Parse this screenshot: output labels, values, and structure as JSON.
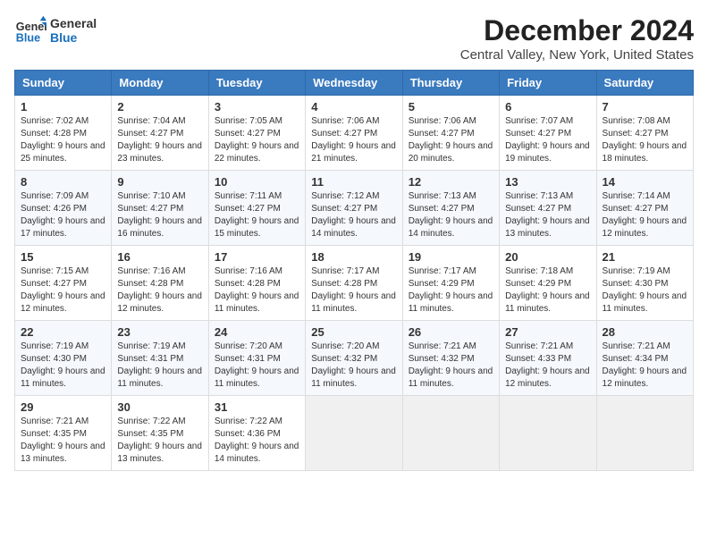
{
  "logo": {
    "line1": "General",
    "line2": "Blue"
  },
  "title": "December 2024",
  "location": "Central Valley, New York, United States",
  "weekdays": [
    "Sunday",
    "Monday",
    "Tuesday",
    "Wednesday",
    "Thursday",
    "Friday",
    "Saturday"
  ],
  "weeks": [
    [
      {
        "day": "1",
        "sunrise": "Sunrise: 7:02 AM",
        "sunset": "Sunset: 4:28 PM",
        "daylight": "Daylight: 9 hours and 25 minutes."
      },
      {
        "day": "2",
        "sunrise": "Sunrise: 7:04 AM",
        "sunset": "Sunset: 4:27 PM",
        "daylight": "Daylight: 9 hours and 23 minutes."
      },
      {
        "day": "3",
        "sunrise": "Sunrise: 7:05 AM",
        "sunset": "Sunset: 4:27 PM",
        "daylight": "Daylight: 9 hours and 22 minutes."
      },
      {
        "day": "4",
        "sunrise": "Sunrise: 7:06 AM",
        "sunset": "Sunset: 4:27 PM",
        "daylight": "Daylight: 9 hours and 21 minutes."
      },
      {
        "day": "5",
        "sunrise": "Sunrise: 7:06 AM",
        "sunset": "Sunset: 4:27 PM",
        "daylight": "Daylight: 9 hours and 20 minutes."
      },
      {
        "day": "6",
        "sunrise": "Sunrise: 7:07 AM",
        "sunset": "Sunset: 4:27 PM",
        "daylight": "Daylight: 9 hours and 19 minutes."
      },
      {
        "day": "7",
        "sunrise": "Sunrise: 7:08 AM",
        "sunset": "Sunset: 4:27 PM",
        "daylight": "Daylight: 9 hours and 18 minutes."
      }
    ],
    [
      {
        "day": "8",
        "sunrise": "Sunrise: 7:09 AM",
        "sunset": "Sunset: 4:26 PM",
        "daylight": "Daylight: 9 hours and 17 minutes."
      },
      {
        "day": "9",
        "sunrise": "Sunrise: 7:10 AM",
        "sunset": "Sunset: 4:27 PM",
        "daylight": "Daylight: 9 hours and 16 minutes."
      },
      {
        "day": "10",
        "sunrise": "Sunrise: 7:11 AM",
        "sunset": "Sunset: 4:27 PM",
        "daylight": "Daylight: 9 hours and 15 minutes."
      },
      {
        "day": "11",
        "sunrise": "Sunrise: 7:12 AM",
        "sunset": "Sunset: 4:27 PM",
        "daylight": "Daylight: 9 hours and 14 minutes."
      },
      {
        "day": "12",
        "sunrise": "Sunrise: 7:13 AM",
        "sunset": "Sunset: 4:27 PM",
        "daylight": "Daylight: 9 hours and 14 minutes."
      },
      {
        "day": "13",
        "sunrise": "Sunrise: 7:13 AM",
        "sunset": "Sunset: 4:27 PM",
        "daylight": "Daylight: 9 hours and 13 minutes."
      },
      {
        "day": "14",
        "sunrise": "Sunrise: 7:14 AM",
        "sunset": "Sunset: 4:27 PM",
        "daylight": "Daylight: 9 hours and 12 minutes."
      }
    ],
    [
      {
        "day": "15",
        "sunrise": "Sunrise: 7:15 AM",
        "sunset": "Sunset: 4:27 PM",
        "daylight": "Daylight: 9 hours and 12 minutes."
      },
      {
        "day": "16",
        "sunrise": "Sunrise: 7:16 AM",
        "sunset": "Sunset: 4:28 PM",
        "daylight": "Daylight: 9 hours and 12 minutes."
      },
      {
        "day": "17",
        "sunrise": "Sunrise: 7:16 AM",
        "sunset": "Sunset: 4:28 PM",
        "daylight": "Daylight: 9 hours and 11 minutes."
      },
      {
        "day": "18",
        "sunrise": "Sunrise: 7:17 AM",
        "sunset": "Sunset: 4:28 PM",
        "daylight": "Daylight: 9 hours and 11 minutes."
      },
      {
        "day": "19",
        "sunrise": "Sunrise: 7:17 AM",
        "sunset": "Sunset: 4:29 PM",
        "daylight": "Daylight: 9 hours and 11 minutes."
      },
      {
        "day": "20",
        "sunrise": "Sunrise: 7:18 AM",
        "sunset": "Sunset: 4:29 PM",
        "daylight": "Daylight: 9 hours and 11 minutes."
      },
      {
        "day": "21",
        "sunrise": "Sunrise: 7:19 AM",
        "sunset": "Sunset: 4:30 PM",
        "daylight": "Daylight: 9 hours and 11 minutes."
      }
    ],
    [
      {
        "day": "22",
        "sunrise": "Sunrise: 7:19 AM",
        "sunset": "Sunset: 4:30 PM",
        "daylight": "Daylight: 9 hours and 11 minutes."
      },
      {
        "day": "23",
        "sunrise": "Sunrise: 7:19 AM",
        "sunset": "Sunset: 4:31 PM",
        "daylight": "Daylight: 9 hours and 11 minutes."
      },
      {
        "day": "24",
        "sunrise": "Sunrise: 7:20 AM",
        "sunset": "Sunset: 4:31 PM",
        "daylight": "Daylight: 9 hours and 11 minutes."
      },
      {
        "day": "25",
        "sunrise": "Sunrise: 7:20 AM",
        "sunset": "Sunset: 4:32 PM",
        "daylight": "Daylight: 9 hours and 11 minutes."
      },
      {
        "day": "26",
        "sunrise": "Sunrise: 7:21 AM",
        "sunset": "Sunset: 4:32 PM",
        "daylight": "Daylight: 9 hours and 11 minutes."
      },
      {
        "day": "27",
        "sunrise": "Sunrise: 7:21 AM",
        "sunset": "Sunset: 4:33 PM",
        "daylight": "Daylight: 9 hours and 12 minutes."
      },
      {
        "day": "28",
        "sunrise": "Sunrise: 7:21 AM",
        "sunset": "Sunset: 4:34 PM",
        "daylight": "Daylight: 9 hours and 12 minutes."
      }
    ],
    [
      {
        "day": "29",
        "sunrise": "Sunrise: 7:21 AM",
        "sunset": "Sunset: 4:35 PM",
        "daylight": "Daylight: 9 hours and 13 minutes."
      },
      {
        "day": "30",
        "sunrise": "Sunrise: 7:22 AM",
        "sunset": "Sunset: 4:35 PM",
        "daylight": "Daylight: 9 hours and 13 minutes."
      },
      {
        "day": "31",
        "sunrise": "Sunrise: 7:22 AM",
        "sunset": "Sunset: 4:36 PM",
        "daylight": "Daylight: 9 hours and 14 minutes."
      },
      null,
      null,
      null,
      null
    ]
  ]
}
